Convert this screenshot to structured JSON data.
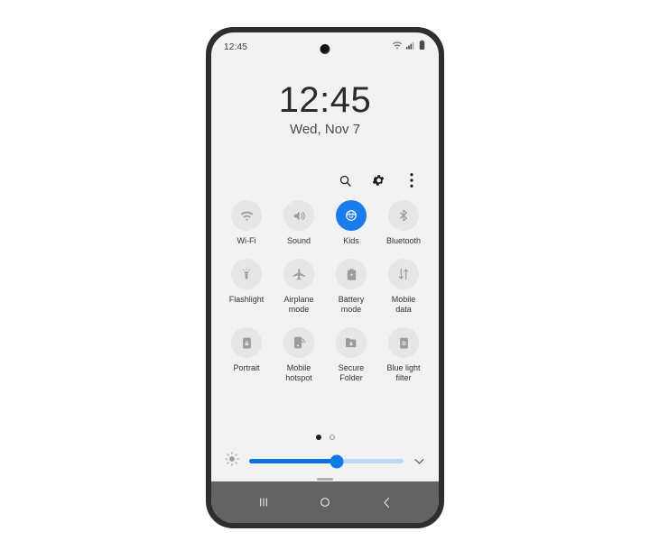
{
  "device": {
    "status_bar": {
      "clock": "12:45",
      "icons": [
        "wifi-icon",
        "signal-icon",
        "battery-icon"
      ]
    },
    "camera": "front-camera-hole"
  },
  "lockscreen": {
    "time": "12:45",
    "date": "Wed, Nov 7"
  },
  "toolbar": {
    "search_label": "search-icon",
    "settings_label": "gear-icon",
    "more_label": "more-options-icon"
  },
  "quick_settings": {
    "tiles": [
      {
        "label": "Wi-Fi",
        "icon": "wifi-icon",
        "active": false
      },
      {
        "label": "Sound",
        "icon": "sound-icon",
        "active": false
      },
      {
        "label": "Kids",
        "icon": "kids-icon",
        "active": true
      },
      {
        "label": "Bluetooth",
        "icon": "bluetooth-icon",
        "active": false
      },
      {
        "label": "Flashlight",
        "icon": "flashlight-icon",
        "active": false
      },
      {
        "label": "Airplane\nmode",
        "icon": "airplane-icon",
        "active": false
      },
      {
        "label": "Battery\nmode",
        "icon": "battery-mode-icon",
        "active": false
      },
      {
        "label": "Mobile\ndata",
        "icon": "mobile-data-icon",
        "active": false
      },
      {
        "label": "Portrait",
        "icon": "portrait-lock-icon",
        "active": false
      },
      {
        "label": "Mobile\nhotspot",
        "icon": "hotspot-icon",
        "active": false
      },
      {
        "label": "Secure\nFolder",
        "icon": "secure-folder-icon",
        "active": false
      },
      {
        "label": "Blue light\nfilter",
        "icon": "blue-light-icon",
        "active": false
      }
    ],
    "page_dots": [
      {
        "state": "active"
      },
      {
        "state": "inactive"
      }
    ],
    "active_color": "#1a7ced",
    "tile_color": "#e6e6e6"
  },
  "brightness": {
    "icon": "brightness-icon",
    "percent": 57,
    "expand_icon": "chevron-down-icon",
    "fill_color": "#0b72e0",
    "track_color": "#bcd9f6"
  },
  "navigation": {
    "recents_label": "recents-icon",
    "home_label": "home-icon",
    "back_label": "back-icon"
  }
}
